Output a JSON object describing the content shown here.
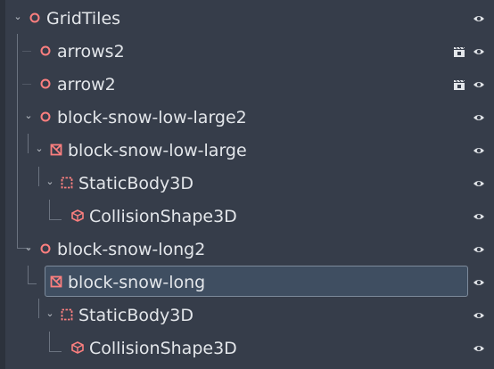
{
  "scene_tree": {
    "nodes": [
      {
        "label": "GridTiles",
        "type_icon": "node3d-icon",
        "expanded": true,
        "scene_instance": false,
        "visible": true,
        "selected": false
      },
      {
        "label": "arrows2",
        "type_icon": "node3d-icon",
        "expanded": null,
        "scene_instance": true,
        "visible": true,
        "selected": false
      },
      {
        "label": "arrow2",
        "type_icon": "node3d-icon",
        "expanded": null,
        "scene_instance": true,
        "visible": true,
        "selected": false
      },
      {
        "label": "block-snow-low-large2",
        "type_icon": "node3d-icon",
        "expanded": true,
        "scene_instance": false,
        "visible": true,
        "selected": false
      },
      {
        "label": "block-snow-low-large",
        "type_icon": "mesh-instance-icon",
        "expanded": true,
        "scene_instance": false,
        "visible": true,
        "selected": false
      },
      {
        "label": "StaticBody3D",
        "type_icon": "static-body-icon",
        "expanded": true,
        "scene_instance": false,
        "visible": true,
        "selected": false
      },
      {
        "label": "CollisionShape3D",
        "type_icon": "collision-shape-icon",
        "expanded": null,
        "scene_instance": false,
        "visible": true,
        "selected": false
      },
      {
        "label": "block-snow-long2",
        "type_icon": "node3d-icon",
        "expanded": true,
        "scene_instance": false,
        "visible": true,
        "selected": false
      },
      {
        "label": "block-snow-long",
        "type_icon": "mesh-instance-icon",
        "expanded": true,
        "scene_instance": false,
        "visible": true,
        "selected": true
      },
      {
        "label": "StaticBody3D",
        "type_icon": "static-body-icon",
        "expanded": true,
        "scene_instance": false,
        "visible": true,
        "selected": false
      },
      {
        "label": "CollisionShape3D",
        "type_icon": "collision-shape-icon",
        "expanded": null,
        "scene_instance": false,
        "visible": true,
        "selected": false
      }
    ]
  },
  "colors": {
    "background": "#363d4a",
    "text": "#e3e6ea",
    "node_icon": "#fc7f7f",
    "selection_fill": "#3f4e61",
    "selection_border": "#7d8a9b",
    "guide_lines": "#6b7380"
  }
}
